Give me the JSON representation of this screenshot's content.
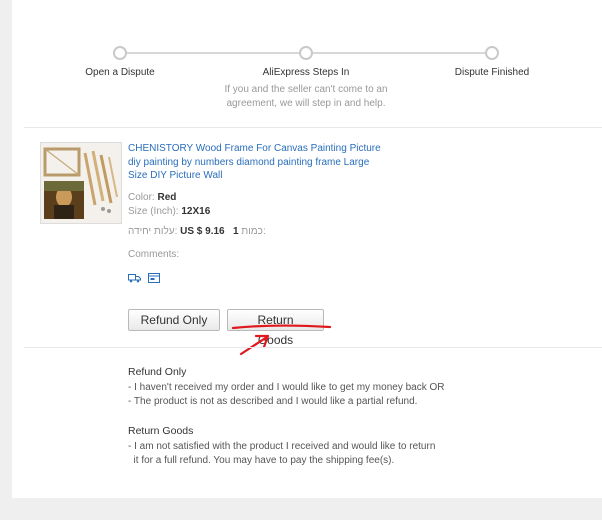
{
  "steps": [
    {
      "title": "Open a Dispute",
      "desc": ""
    },
    {
      "title": "AliExpress Steps In",
      "desc": "If you and the seller can't come to an agreement, we will step in and help."
    },
    {
      "title": "Dispute Finished",
      "desc": ""
    }
  ],
  "product": {
    "title": "CHENISTORY Wood Frame For Canvas Painting Picture diy painting by numbers diamond painting frame Large Size DIY Picture Wall",
    "color_label": "Color:",
    "color_value": "Red",
    "size_label": "Size (Inch):",
    "size_value": "12X16",
    "unit_price_label": "עלות יחידה:",
    "price": "US $ 9.16",
    "qty_label": "כמות:",
    "qty": "1",
    "comments_label": "Comments:"
  },
  "icons": [
    "truck-icon",
    "card-icon"
  ],
  "buttons": {
    "refund_only": "Refund Only",
    "return_goods": "Return Goods"
  },
  "info": {
    "refund_only": {
      "title": "Refund Only",
      "lines": [
        "- I haven't received my order and I would like to get my money back OR",
        "- The product is not as described and I would like a partial refund."
      ]
    },
    "return_goods": {
      "title": "Return Goods",
      "lines": [
        "- I am not satisfied with the product I received and would like to return",
        "  it for a full refund. You may have to pay the shipping fee(s)."
      ]
    }
  },
  "annotation_color": "#e0191e",
  "link_color": "#2a6ebb"
}
